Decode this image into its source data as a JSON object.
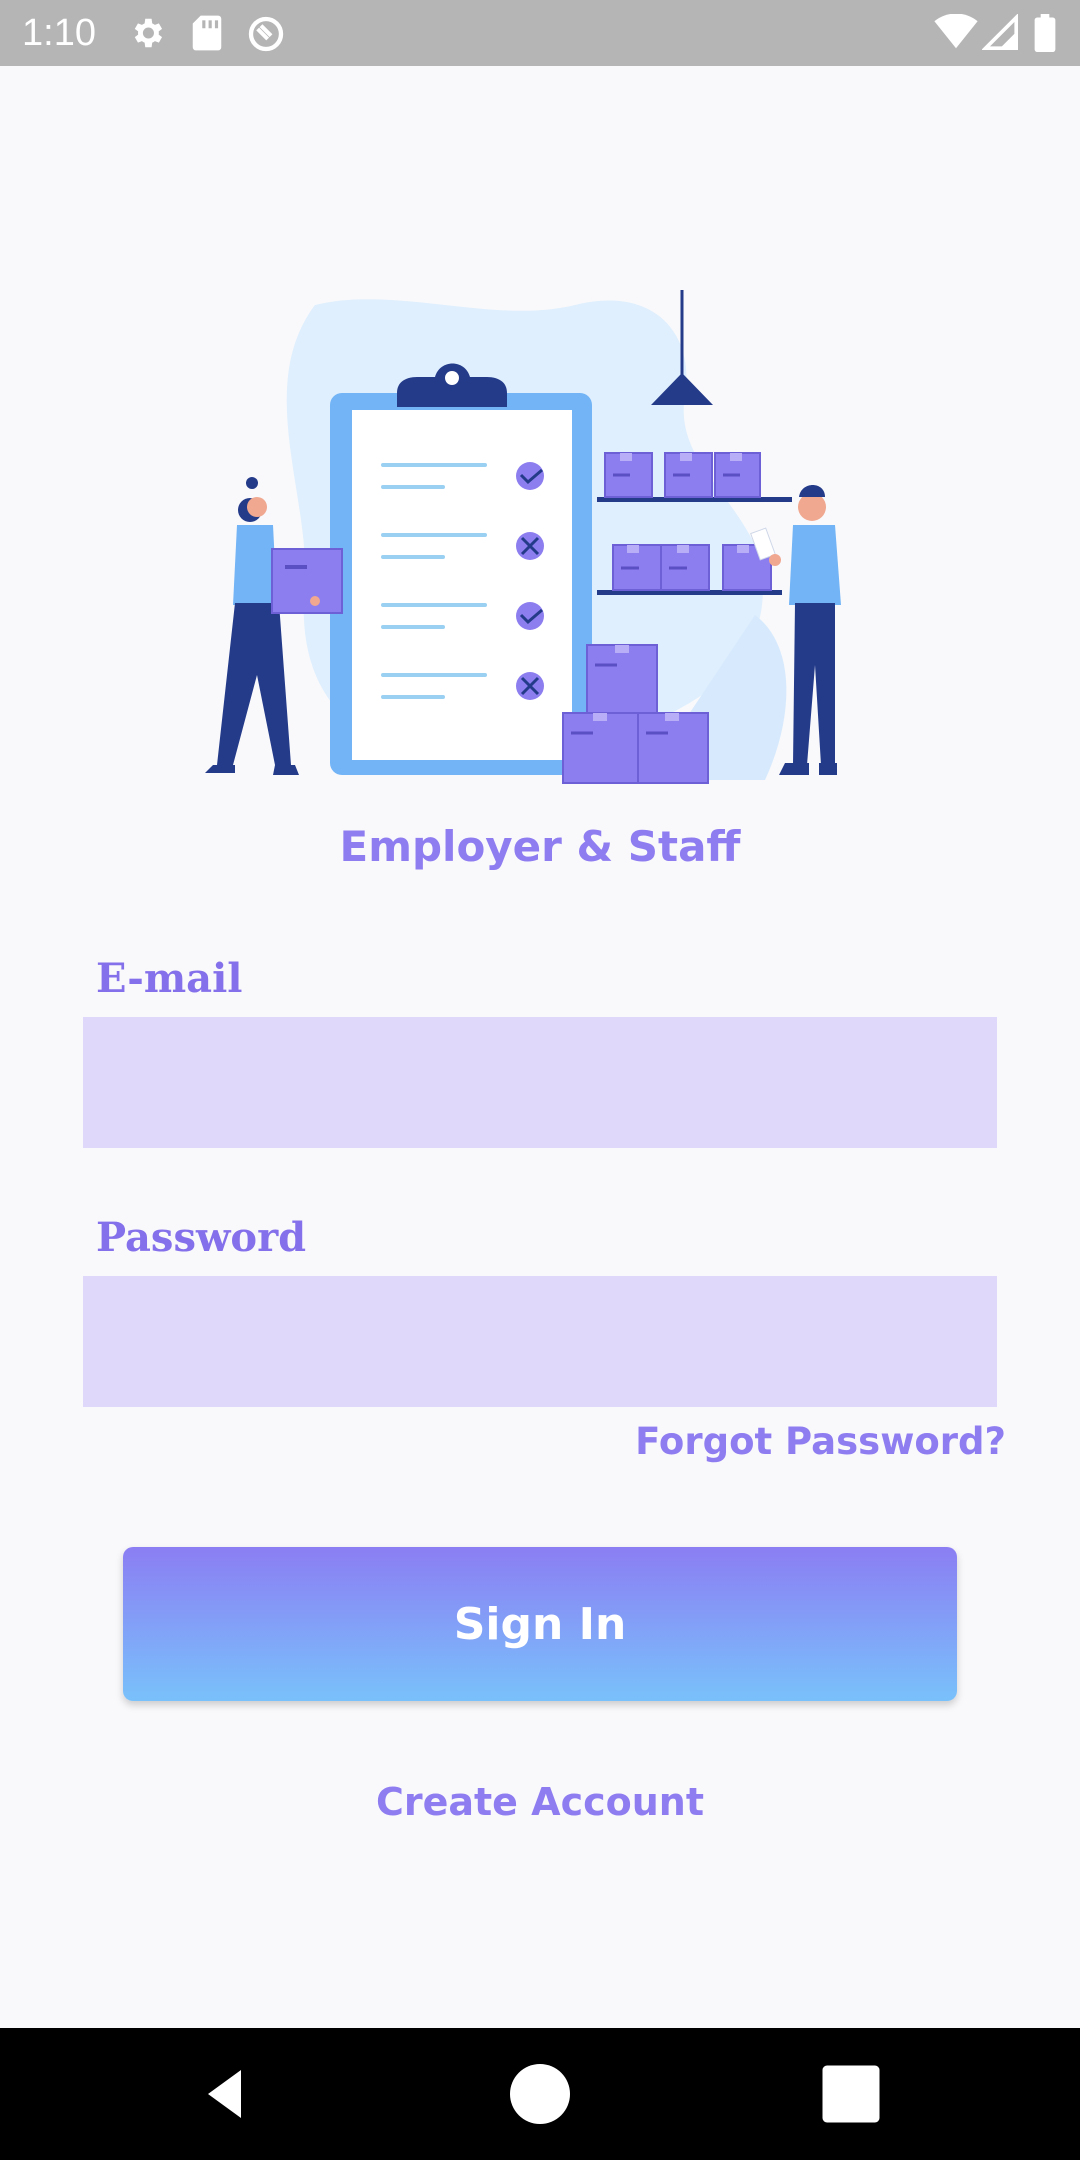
{
  "status_bar": {
    "time": "1:10",
    "icons": [
      "gear-icon",
      "sd-card-icon",
      "sync-icon",
      "wifi-icon",
      "signal-icon",
      "battery-icon"
    ]
  },
  "app": {
    "title": "Employer & Staff"
  },
  "form": {
    "email_label": "E-mail",
    "email_value": "",
    "password_label": "Password",
    "password_value": "",
    "forgot_label": "Forgot Password?",
    "signin_label": "Sign In",
    "create_label": "Create Account"
  },
  "nav": {
    "icons": [
      "back-icon",
      "home-icon",
      "recents-icon"
    ]
  },
  "colors": {
    "accent": "#8e7cf1",
    "input_bg": "#dfd8fa",
    "button_top": "#8b7ef3",
    "button_bottom": "#79c1fb"
  }
}
